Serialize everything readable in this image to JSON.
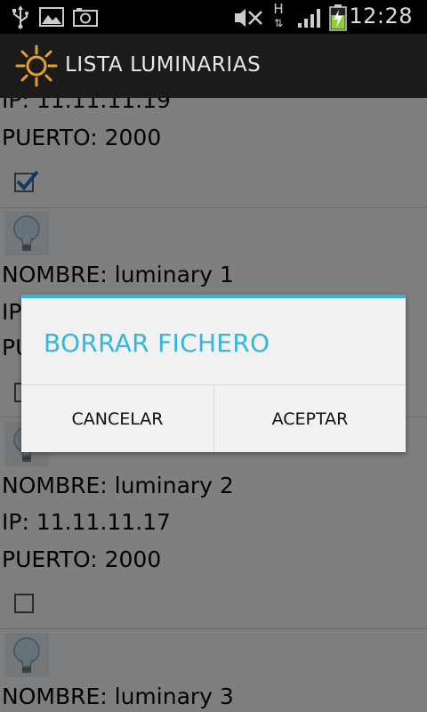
{
  "status_bar": {
    "time": "12:28",
    "icons": [
      "usb-icon",
      "gallery-icon",
      "camera-icon",
      "mute-icon",
      "network-h-icon",
      "signal-icon",
      "battery-charging-icon"
    ],
    "network_label": "H"
  },
  "action_bar": {
    "title": "LISTA LUMINARIAS",
    "icon": "sun-icon"
  },
  "list": {
    "items": [
      {
        "ip": "IP: 11.11.11.19",
        "port": "PUERTO: 2000",
        "checked": true
      },
      {
        "name": "NOMBRE: luminary 1",
        "ip": "IP",
        "port": "PU",
        "checked": false
      },
      {
        "name": "NOMBRE: luminary 2",
        "ip": "IP: 11.11.11.17",
        "port": "PUERTO: 2000",
        "checked": false
      },
      {
        "name": "NOMBRE: luminary 3"
      }
    ]
  },
  "dialog": {
    "title": "BORRAR FICHERO",
    "cancel_label": "CANCELAR",
    "accept_label": "ACEPTAR",
    "accent_color": "#33b5e5"
  }
}
